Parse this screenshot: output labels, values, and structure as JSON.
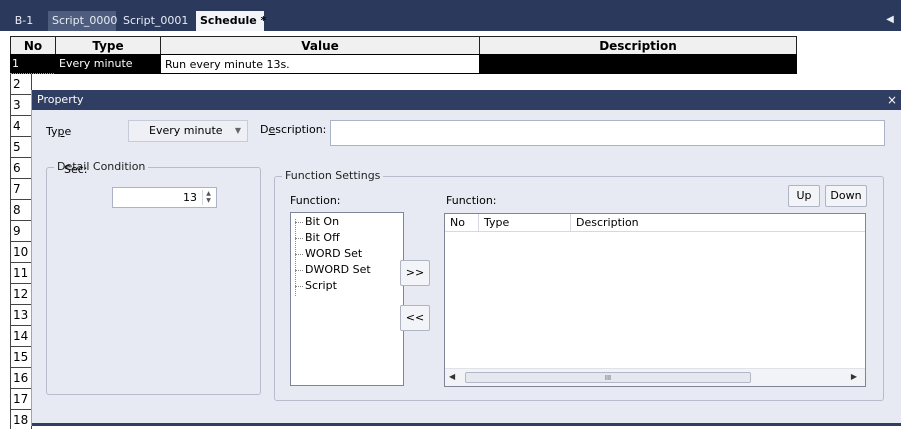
{
  "tabs": {
    "items": [
      {
        "label": "B-1"
      },
      {
        "label": "Script_0000"
      },
      {
        "label": "Script_0001"
      },
      {
        "label": "Schedule *"
      }
    ],
    "scroll_icon": "chevron-left-icon"
  },
  "grid": {
    "columns": [
      "No",
      "Type",
      "Value",
      "Description"
    ],
    "selected_row": {
      "no": "1",
      "type": "Every minute",
      "value": "Run every minute 13s.",
      "description": ""
    },
    "row_numbers": [
      "2",
      "3",
      "4",
      "5",
      "6",
      "7",
      "8",
      "9",
      "10",
      "11",
      "12",
      "13",
      "14",
      "15",
      "16",
      "17",
      "18"
    ]
  },
  "dialog": {
    "title": "Property",
    "close": "×",
    "type_label": "Type",
    "type_value": "Every minute",
    "description_label": "Description:",
    "description_value": "",
    "detail_condition": {
      "title": "Detail Condition",
      "sec_label": "Sec:",
      "sec_value": "13"
    },
    "function_settings": {
      "title": "Function Settings",
      "left_label": "Function:",
      "right_label": "Function:",
      "tree_items": [
        "Bit On",
        "Bit Off",
        "WORD Set",
        "DWORD Set",
        "Script"
      ],
      "add_button": ">>",
      "remove_button": "<<",
      "up_button": "Up",
      "down_button": "Down",
      "list_columns": [
        "No",
        "Type",
        "Description"
      ],
      "scroll_thumb": "III"
    }
  }
}
